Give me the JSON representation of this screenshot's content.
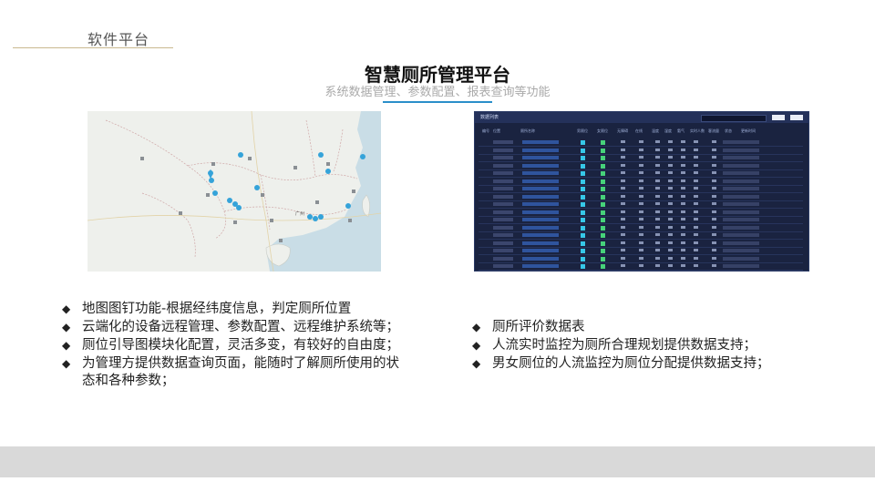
{
  "header": {
    "section_label": "软件平台",
    "title": "智慧厕所管理平台",
    "subtitle": "系统数据管理、参数配置、报表查询等功能"
  },
  "map_panel": {
    "pin_color": "#35a3d9",
    "labels": [
      "广州"
    ]
  },
  "table_panel": {
    "title": "数据列表",
    "buttons": [
      "查询",
      "导出"
    ],
    "columns": [
      "编号",
      "位置",
      "厕所名称",
      "男厕位",
      "女厕位",
      "无障碍",
      "在线",
      "温度",
      "湿度",
      "氨气",
      "实时人数",
      "客流量",
      "状态",
      "更新时间"
    ]
  },
  "left_bullets": [
    "地图图钉功能-根据经纬度信息，判定厕所位置",
    "云端化的设备远程管理、参数配置、远程维护系统等；",
    "厕位引导图模块化配置，灵活多变，有较好的自由度；",
    "为管理方提供数据查询页面，能随时了解厕所使用的状态和各种参数；"
  ],
  "right_bullets": [
    "厕所评价数据表",
    "人流实时监控为厕所合理规划提供数据支持；",
    "男女厕位的人流监控为厕位分配提供数据支持；"
  ],
  "bullet_glyph": "◆"
}
